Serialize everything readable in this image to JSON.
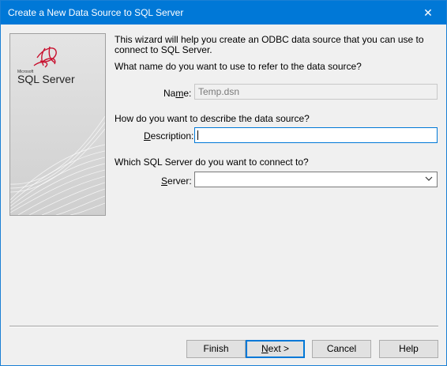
{
  "window": {
    "title": "Create a New Data Source to SQL Server",
    "close_glyph": "✕"
  },
  "logo": {
    "brand_small": "Microsoft",
    "brand_large": "SQL Server"
  },
  "intro": "This wizard will help you create an ODBC data source that you can use to connect to SQL Server.",
  "name_section": {
    "question": "What name do you want to use to refer to the data source?",
    "label_underlined": "m",
    "label_pre": "Na",
    "label_post": "e:",
    "value": "Temp.dsn"
  },
  "description_section": {
    "question": "How do you want to describe the data source?",
    "label_underlined": "D",
    "label_post": "escription:",
    "value": ""
  },
  "server_section": {
    "question": "Which SQL Server do you want to connect to?",
    "label_underlined": "S",
    "label_post": "erver:",
    "value": ""
  },
  "buttons": {
    "finish": "Finish",
    "next_underlined": "N",
    "next_post": "ext >",
    "cancel": "Cancel",
    "help": "Help"
  },
  "colors": {
    "accent": "#0078d7",
    "logo_red": "#c8102e"
  }
}
